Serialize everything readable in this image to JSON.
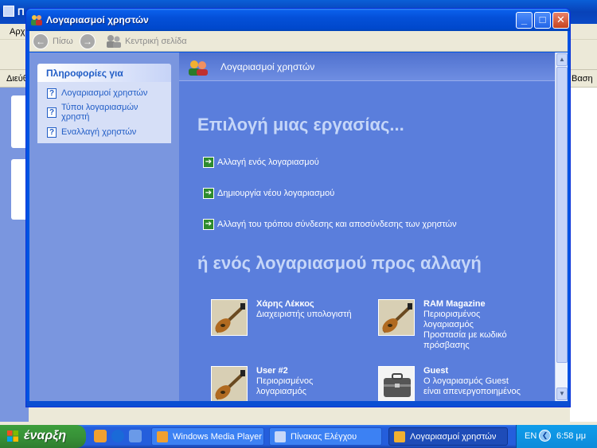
{
  "background_window": {
    "title": "Π",
    "menu": "Αρχ",
    "address_label": "Διεύθ",
    "go_label": "Βαση"
  },
  "window": {
    "title": "Λογαριασμοί χρηστών",
    "controls": {
      "minimize": "_",
      "maximize": "□",
      "close": "✕"
    }
  },
  "navigation": {
    "back_label": "Πίσω",
    "home_label": "Κεντρική σελίδα"
  },
  "left_panel": {
    "heading": "Πληροφορίες για",
    "items": [
      {
        "label": "Λογαριασμοί χρηστών"
      },
      {
        "label": "Τύποι λογαριασμών",
        "label_line2": "χρηστή"
      },
      {
        "label": "Εναλλαγή χρηστών"
      }
    ]
  },
  "main": {
    "header_title": "Λογαριασμοί χρηστών",
    "pick_task_heading": "Επιλογή μιας εργασίας...",
    "tasks": [
      {
        "label": "Αλλαγή ενός λογαριασμού"
      },
      {
        "label": "Δημιουργία νέου λογαριασμού"
      },
      {
        "label": "Αλλαγή του τρόπου σύνδεσης και αποσύνδεσης των χρηστών"
      }
    ],
    "pick_account_heading": "ή ενός λογαριασμού προς αλλαγή",
    "accounts": [
      {
        "name": "Χάρης Λέκκος",
        "description": [
          "Διαχειριστής υπολογιστή"
        ],
        "picture": "guitar-icon"
      },
      {
        "name": "RAM Magazine",
        "description": [
          "Περιορισμένος",
          "λογαριασμός",
          "Προστασία με κωδικό",
          "πρόσβασης"
        ],
        "picture": "guitar-icon"
      },
      {
        "name": "User #2",
        "description": [
          "Περιορισμένος",
          "λογαριασμός"
        ],
        "picture": "guitar-icon"
      },
      {
        "name": "Guest",
        "description": [
          "Ο λογαριασμός Guest",
          "είναι απενεργοποιημένος"
        ],
        "picture": "briefcase-icon"
      }
    ]
  },
  "taskbar": {
    "start_label": "έναρξη",
    "buttons": [
      {
        "label": "Windows Media Player",
        "active": false
      },
      {
        "label": "Πίνακας Ελέγχου",
        "active": false
      },
      {
        "label": "Λογαριασμοί χρηστών",
        "active": true
      }
    ],
    "language": "EN",
    "clock": "6:58 μμ"
  },
  "colors": {
    "pane_blue": "#7A96DF",
    "content_blue": "#5A7EDC",
    "link_blue": "#215DC6",
    "heading_light": "#C5D6F8",
    "start_green": "#389238"
  }
}
